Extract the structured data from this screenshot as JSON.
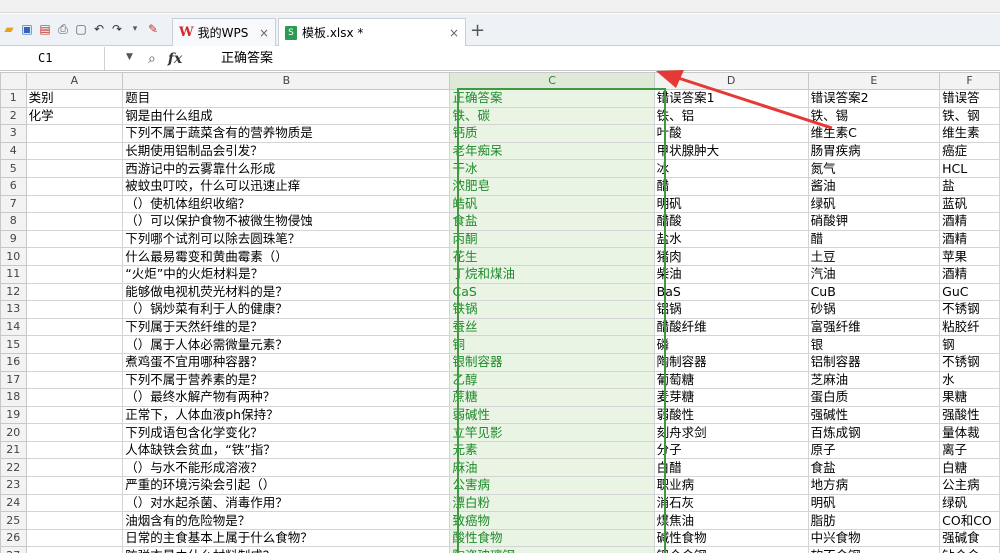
{
  "tabs": [
    {
      "label": "我的WPS",
      "active": false
    },
    {
      "label": "模板.xlsx *",
      "active": true
    }
  ],
  "formula_bar": {
    "cell_ref": "C1",
    "fx": "fx",
    "content": "正确答案"
  },
  "columns": [
    "A",
    "B",
    "C",
    "D",
    "E",
    "F"
  ],
  "rows": [
    {
      "n": "1",
      "a": "类别",
      "b": "题目",
      "c": "正确答案",
      "d": "错误答案1",
      "e": "错误答案2",
      "f": "错误答"
    },
    {
      "n": "2",
      "a": "化学",
      "b": "钢是由什么组成",
      "c": "铁、碳",
      "d": "铁、铝",
      "e": "铁、锡",
      "f": "铁、钢"
    },
    {
      "n": "3",
      "a": "",
      "b": "下列不属于蔬菜含有的营养物质是",
      "c": "钙质",
      "d": "叶酸",
      "e": "维生素C",
      "f": "维生素"
    },
    {
      "n": "4",
      "a": "",
      "b": "长期使用铝制品会引发？",
      "c": "老年痴呆",
      "d": "甲状腺肿大",
      "e": "肠胃疾病",
      "f": "癌症"
    },
    {
      "n": "5",
      "a": "",
      "b": "西游记中的云雾靠什么形成",
      "c": "干冰",
      "d": "冰",
      "e": "氮气",
      "f": "HCL"
    },
    {
      "n": "6",
      "a": "",
      "b": "被蚊虫叮咬，什么可以迅速止痒",
      "c": "浓肥皂",
      "d": "醋",
      "e": "酱油",
      "f": "盐"
    },
    {
      "n": "7",
      "a": "",
      "b": "（）使机体组织收缩？",
      "c": "皓矾",
      "d": "明矾",
      "e": "绿矾",
      "f": "蓝矾"
    },
    {
      "n": "8",
      "a": "",
      "b": "（）可以保护食物不被微生物侵蚀",
      "c": "食盐",
      "d": "醋酸",
      "e": "硝酸钾",
      "f": "酒精"
    },
    {
      "n": "9",
      "a": "",
      "b": "下列哪个试剂可以除去圆珠笔？",
      "c": "丙酮",
      "d": "盐水",
      "e": "醋",
      "f": "酒精"
    },
    {
      "n": "10",
      "a": "",
      "b": "什么最易霉变和黄曲霉素（）",
      "c": "花生",
      "d": "猪肉",
      "e": "土豆",
      "f": "苹果"
    },
    {
      "n": "11",
      "a": "",
      "b": "“火炬”中的火炬材料是？",
      "c": "丁烷和煤油",
      "d": "柴油",
      "e": "汽油",
      "f": "酒精"
    },
    {
      "n": "12",
      "a": "",
      "b": "能够做电视机荧光材料的是？",
      "c": "CaS",
      "d": "BaS",
      "e": "CuB",
      "f": "GuC"
    },
    {
      "n": "13",
      "a": "",
      "b": "（）锅炒菜有利于人的健康？",
      "c": "铁锅",
      "d": "铝锅",
      "e": "砂锅",
      "f": "不锈钢"
    },
    {
      "n": "14",
      "a": "",
      "b": "下列属于天然纤维的是？",
      "c": "蚕丝",
      "d": "醋酸纤维",
      "e": "富强纤维",
      "f": "粘胶纤"
    },
    {
      "n": "15",
      "a": "",
      "b": "（）属于人体必需微量元素？",
      "c": "铜",
      "d": "磷",
      "e": "银",
      "f": "钢"
    },
    {
      "n": "16",
      "a": "",
      "b": "煮鸡蛋不宜用哪种容器？",
      "c": "银制容器",
      "d": "陶制容器",
      "e": "铝制容器",
      "f": "不锈钢"
    },
    {
      "n": "17",
      "a": "",
      "b": "下列不属于营养素的是？",
      "c": "乙醇",
      "d": "葡萄糖",
      "e": "芝麻油",
      "f": "水"
    },
    {
      "n": "18",
      "a": "",
      "b": "（）最终水解产物有两种？",
      "c": "蔗糖",
      "d": "麦芽糖",
      "e": "蛋白质",
      "f": "果糖"
    },
    {
      "n": "19",
      "a": "",
      "b": "正常下，人体血液ph保持？",
      "c": "弱碱性",
      "d": "弱酸性",
      "e": "强碱性",
      "f": "强酸性"
    },
    {
      "n": "20",
      "a": "",
      "b": "下列成语包含化学变化？",
      "c": "立竿见影",
      "d": "刻舟求剑",
      "e": "百炼成钢",
      "f": "量体裁"
    },
    {
      "n": "21",
      "a": "",
      "b": "人体缺铁会贫血，“铁”指？",
      "c": "元素",
      "d": "分子",
      "e": "原子",
      "f": "离子"
    },
    {
      "n": "22",
      "a": "",
      "b": "（）与水不能形成溶液？",
      "c": "麻油",
      "d": "白醋",
      "e": "食盐",
      "f": "白糖"
    },
    {
      "n": "23",
      "a": "",
      "b": "严重的环境污染会引起（）",
      "c": "公害病",
      "d": "职业病",
      "e": "地方病",
      "f": "公主病"
    },
    {
      "n": "24",
      "a": "",
      "b": "（）对水起杀菌、消毒作用？",
      "c": "漂白粉",
      "d": "消石灰",
      "e": "明矾",
      "f": "绿矾"
    },
    {
      "n": "25",
      "a": "",
      "b": "油烟含有的危险物是？",
      "c": "致癌物",
      "d": "煤焦油",
      "e": "脂肪",
      "f": "CO和CO"
    },
    {
      "n": "26",
      "a": "",
      "b": "日常的主食基本上属于什么食物？",
      "c": "酸性食物",
      "d": "碱性食物",
      "e": "中兴食物",
      "f": "强碱食"
    },
    {
      "n": "27",
      "a": "",
      "b": "防弹衣是由什么材料制成？",
      "c": "陶瓷玻璃钢",
      "d": "铝合金钢",
      "e": "软不金钢",
      "f": "钻合金"
    }
  ],
  "colors": {
    "selected_column_bg": "#eaf4e4",
    "selected_column_text": "#1f8a2c",
    "selection_outline": "#3f9a3f",
    "annotation_arrow": "#e53935"
  }
}
